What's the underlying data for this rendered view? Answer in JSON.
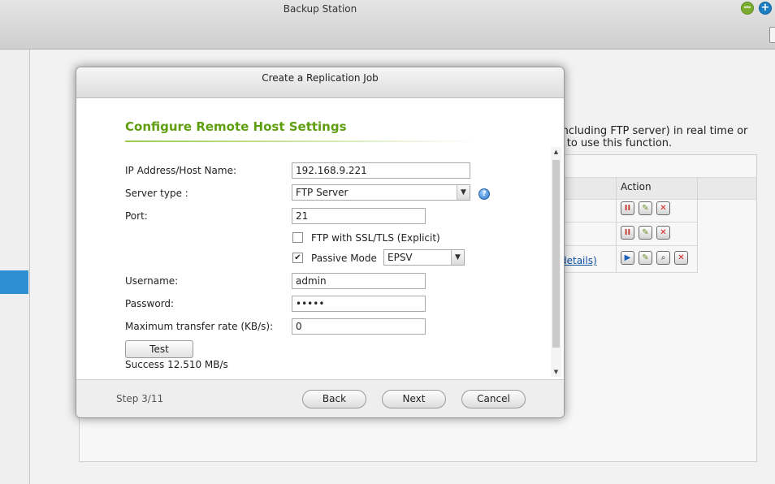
{
  "app": {
    "title": "Backup Station",
    "minimize_icon": "minus-circle-icon",
    "add_icon": "plus-circle-icon"
  },
  "background": {
    "description_line1": "s (including FTP server) in real time or",
    "description_line2": "der to use this function.",
    "table_action_header": "Action",
    "details_link": "details)"
  },
  "dialog": {
    "title": "Create a Replication Job",
    "section_title": "Configure Remote Host Settings",
    "fields": {
      "ip_label": "IP Address/Host Name:",
      "ip_value": "192.168.9.221",
      "server_type_label": "Server type :",
      "server_type_value": "FTP Server",
      "port_label": "Port:",
      "port_value": "21",
      "ssl_label": "FTP with SSL/TLS (Explicit)",
      "ssl_checked": false,
      "passive_label": "Passive Mode",
      "passive_checked": true,
      "passive_mode_value": "EPSV",
      "username_label": "Username:",
      "username_value": "admin",
      "password_label": "Password:",
      "password_value": "•••••",
      "rate_label": "Maximum transfer rate (KB/s):",
      "rate_value": "0"
    },
    "test_button": "Test",
    "test_result": "Success 12.510 MB/s",
    "footer": {
      "step": "Step 3/11",
      "back": "Back",
      "next": "Next",
      "cancel": "Cancel"
    }
  },
  "colors": {
    "accent_green": "#5f9e0f",
    "selection_blue": "#2e8fd2",
    "link_blue": "#0c4fa3"
  }
}
